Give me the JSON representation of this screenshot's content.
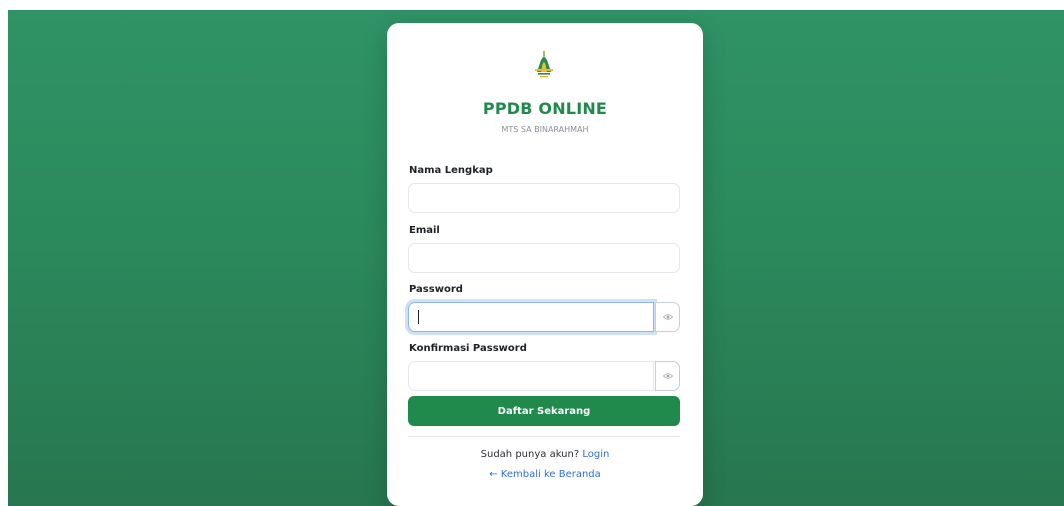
{
  "brand": {
    "title": "PPDB ONLINE",
    "subtitle": "MTS SA BINARAHMAH",
    "logo_icon": "mosque-dome-icon",
    "primary_color": "#1f8a4c",
    "link_color": "#2f6fd6"
  },
  "form": {
    "full_name": {
      "label": "Nama Lengkap",
      "value": ""
    },
    "email": {
      "label": "Email",
      "value": ""
    },
    "password": {
      "label": "Password",
      "value": "",
      "toggle_icon": "eye-icon"
    },
    "confirm_password": {
      "label": "Konfirmasi Password",
      "value": "",
      "toggle_icon": "eye-icon"
    },
    "submit_label": "Daftar Sekarang"
  },
  "footer": {
    "login_prompt": "Sudah punya akun?",
    "login_link": "Login",
    "back_link": "← Kembali ke Beranda"
  }
}
